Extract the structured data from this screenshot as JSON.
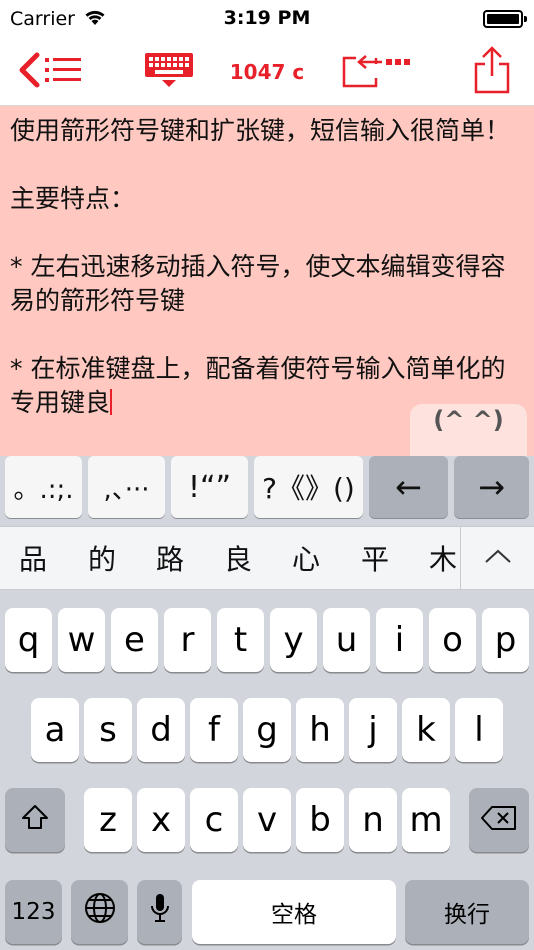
{
  "status_bar": {
    "carrier": "Carrier",
    "time": "3:19 PM"
  },
  "toolbar": {
    "char_count": "1047 c",
    "accent_color": "#e8202a",
    "icons": [
      "back-list-icon",
      "keyboard-hide-icon",
      "insert-symbol-icon",
      "share-icon"
    ]
  },
  "editor": {
    "text": "使用箭形符号键和扩张键，短信输入很简单！\n\n主要特点：\n\n* 左右迅速移动插入符号，使文本编辑变得容易的箭形符号键\n\n* 在标准键盘上，配备着使符号输入简单化的专用键良",
    "background_color": "#ffc8c0",
    "emoticon_label": "(^ ^)"
  },
  "symbol_bar": {
    "keys": [
      "。.:;.",
      ",、···",
      "!“”",
      "?《》()",
      "←",
      "→"
    ]
  },
  "candidates": {
    "items": [
      "品",
      "的",
      "路",
      "良",
      "心",
      "平",
      "木"
    ]
  },
  "keyboard": {
    "row1": [
      "q",
      "w",
      "e",
      "r",
      "t",
      "y",
      "u",
      "i",
      "o",
      "p"
    ],
    "row2": [
      "a",
      "s",
      "d",
      "f",
      "g",
      "h",
      "j",
      "k",
      "l"
    ],
    "row3": [
      "z",
      "x",
      "c",
      "v",
      "b",
      "n",
      "m"
    ],
    "numbers_label": "123",
    "space_label": "空格",
    "return_label": "换行"
  }
}
